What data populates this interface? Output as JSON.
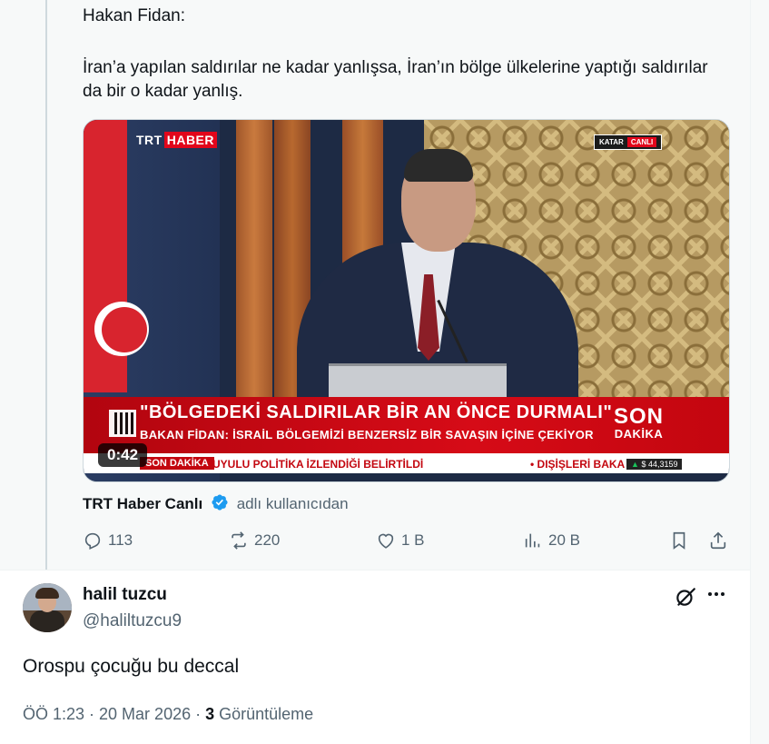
{
  "quoted_tweet": {
    "author_line": "Hakan Fidan:",
    "text": "İran’a yapılan saldırılar ne kadar yanlışsa, İran’ın bölge ülkelerine yaptığı saldırılar da bir o kadar yanlış.",
    "video": {
      "channel_logo_trt": "TRT",
      "channel_logo_haber": "HABER",
      "location_tag": "KATAR",
      "live_tag": "CANLI",
      "headline": "\"BÖLGEDEKİ SALDIRILAR BİR AN ÖNCE DURMALI\"",
      "subheadline": "BAKAN FİDAN: İSRAİL BÖLGEMİZİ BENZERSİZ BİR SAVAŞIN İÇİNE ÇEKİYOR",
      "son": "SON",
      "dakika": "DAKİKA",
      "ticker_label": "SON DAKİKA",
      "ticker_text_1": "UYULU POLİTİKA İZLENDİĞİ BELİRTİLDİ",
      "ticker_text_2": "• DIŞİŞLERİ BAKA",
      "ticker_stock": "$ 44,3159",
      "duration": "0:42"
    },
    "source_name": "TRT Haber Canlı",
    "source_suffix": "adlı kullanıcıdan",
    "actions": {
      "replies": "113",
      "reposts": "220",
      "likes": "1 B",
      "views": "20 B"
    }
  },
  "reply_tweet": {
    "display_name": "halil tuzcu",
    "handle": "@haliltuzcu9",
    "text": "Orospu çocuğu bu deccal",
    "time": "ÖÖ 1:23 · 20 Mar 2026 · ",
    "view_count": "3",
    "view_label": " Görüntüleme"
  },
  "colors": {
    "text_primary": "#0f1419",
    "text_secondary": "#536471",
    "verified_blue": "#1d9bf0",
    "trt_red": "#e2061b"
  },
  "icons": [
    "reply-icon",
    "repost-icon",
    "like-icon",
    "views-icon",
    "bookmark-icon",
    "share-icon",
    "verified-badge-icon",
    "grok-icon",
    "more-icon"
  ]
}
